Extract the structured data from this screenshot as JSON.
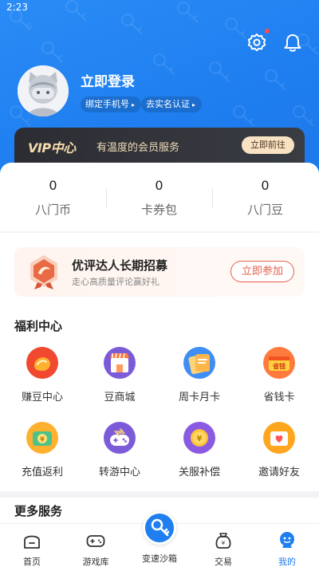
{
  "status_bar": {
    "time": "2:23"
  },
  "header": {
    "settings_icon": "gear-icon",
    "notification_icon": "bell-icon",
    "has_notification_dot": true
  },
  "profile": {
    "login_text": "立即登录",
    "bind_phone": "绑定手机号",
    "verify_identity": "去实名认证",
    "avatar_icon": "default-avatar-icon"
  },
  "vip": {
    "logo": "VIP中心",
    "description": "有温度的会员服务",
    "button": "立即前往"
  },
  "stats": [
    {
      "value": "0",
      "label": "八门币"
    },
    {
      "value": "0",
      "label": "卡券包"
    },
    {
      "value": "0",
      "label": "八门豆"
    }
  ],
  "promo": {
    "title": "优评达人长期招募",
    "subtitle": "走心高质量评论赢好礼",
    "button": "立即参加"
  },
  "welfare": {
    "title": "福利中心",
    "items": [
      {
        "label": "赚豆中心",
        "icon": "earn-beans-icon"
      },
      {
        "label": "豆商城",
        "icon": "bean-mall-icon"
      },
      {
        "label": "周卡月卡",
        "icon": "week-month-card-icon"
      },
      {
        "label": "省钱卡",
        "icon": "save-money-card-icon"
      },
      {
        "label": "充值返利",
        "icon": "recharge-rebate-icon"
      },
      {
        "label": "转游中心",
        "icon": "game-transfer-icon"
      },
      {
        "label": "关服补偿",
        "icon": "server-close-compensation-icon"
      },
      {
        "label": "邀请好友",
        "icon": "invite-friends-icon"
      }
    ]
  },
  "more_services": {
    "title": "更多服务"
  },
  "tabbar": {
    "active": "我的",
    "items": [
      {
        "label": "首页",
        "icon": "home-icon"
      },
      {
        "label": "游戏库",
        "icon": "gamepad-icon"
      },
      {
        "label": "变速沙箱",
        "icon": "key-icon"
      },
      {
        "label": "交易",
        "icon": "trade-bag-icon"
      },
      {
        "label": "我的",
        "icon": "profile-icon"
      }
    ]
  },
  "colors": {
    "primary": "#1f7ff0",
    "vip_gold": "#f6dcae",
    "promo_red": "#e2614f"
  }
}
